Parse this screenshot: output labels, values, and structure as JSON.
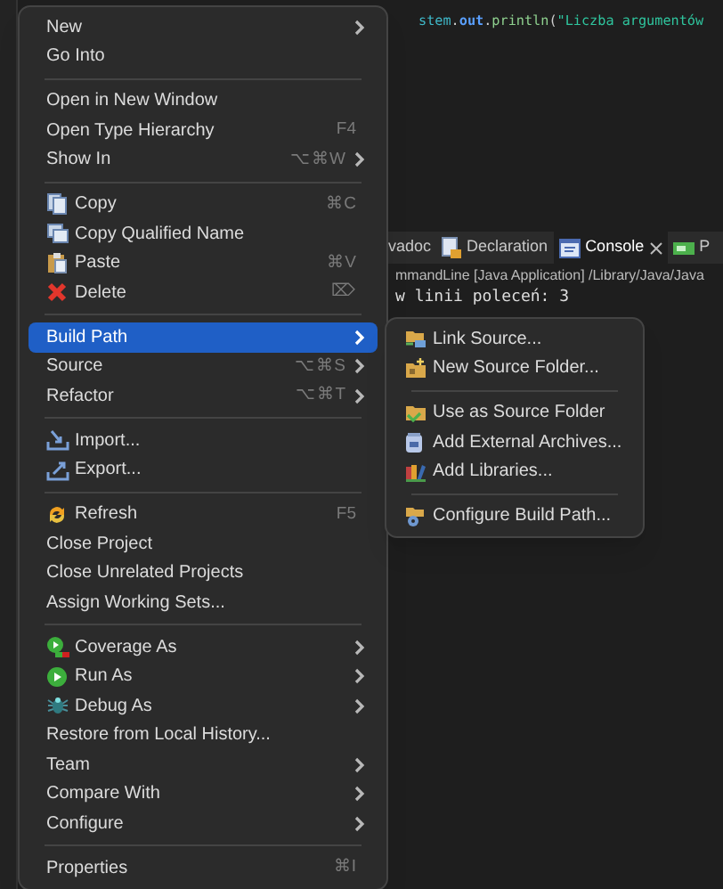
{
  "editor": {
    "code_tokens": [
      {
        "kind": "ident",
        "text": "stem"
      },
      {
        "kind": "punct",
        "text": "."
      },
      {
        "kind": "field",
        "text": "out"
      },
      {
        "kind": "punct",
        "text": "."
      },
      {
        "kind": "method",
        "text": "println"
      },
      {
        "kind": "punct",
        "text": "("
      },
      {
        "kind": "string",
        "text": "\"Liczba argumentów"
      }
    ]
  },
  "bottom_panel": {
    "tabs": [
      {
        "label": "vadoc",
        "selected": false
      },
      {
        "label": "Declaration",
        "selected": false
      },
      {
        "label": "Console",
        "selected": true
      },
      {
        "label": "P",
        "selected": false
      }
    ],
    "console_header": "mmandLine [Java Application] /Library/Java/Java",
    "console_output": "w linii poleceń: 3"
  },
  "context_menu": {
    "items": [
      {
        "kind": "item",
        "label": "New",
        "submenu": true,
        "selected": false
      },
      {
        "kind": "item",
        "label": "Go Into",
        "submenu": false,
        "selected": false
      },
      {
        "kind": "separator"
      },
      {
        "kind": "item",
        "label": "Open in New Window",
        "submenu": false,
        "selected": false
      },
      {
        "kind": "item",
        "label": "Open Type Hierarchy",
        "shortcut": "F4",
        "submenu": false,
        "selected": false
      },
      {
        "kind": "item",
        "label": "Show In",
        "shortcut": "⌥⌘W",
        "submenu": true,
        "selected": false
      },
      {
        "kind": "separator"
      },
      {
        "kind": "item",
        "label": "Copy",
        "shortcut": "⌘C",
        "submenu": false,
        "selected": false
      },
      {
        "kind": "item",
        "label": "Copy Qualified Name",
        "submenu": false,
        "selected": false
      },
      {
        "kind": "item",
        "label": "Paste",
        "shortcut": "⌘V",
        "submenu": false,
        "selected": false
      },
      {
        "kind": "item",
        "label": "Delete",
        "shortcut": "⌦",
        "submenu": false,
        "selected": false
      },
      {
        "kind": "separator"
      },
      {
        "kind": "item",
        "label": "Build Path",
        "submenu": true,
        "selected": true
      },
      {
        "kind": "item",
        "label": "Source",
        "shortcut": "⌥⌘S",
        "submenu": true,
        "selected": false
      },
      {
        "kind": "item",
        "label": "Refactor",
        "shortcut": "⌥⌘T",
        "submenu": true,
        "selected": false
      },
      {
        "kind": "separator"
      },
      {
        "kind": "item",
        "label": "Import...",
        "submenu": false,
        "selected": false
      },
      {
        "kind": "item",
        "label": "Export...",
        "submenu": false,
        "selected": false
      },
      {
        "kind": "separator"
      },
      {
        "kind": "item",
        "label": "Refresh",
        "shortcut": "F5",
        "submenu": false,
        "selected": false
      },
      {
        "kind": "item",
        "label": "Close Project",
        "submenu": false,
        "selected": false
      },
      {
        "kind": "item",
        "label": "Close Unrelated Projects",
        "submenu": false,
        "selected": false
      },
      {
        "kind": "item",
        "label": "Assign Working Sets...",
        "submenu": false,
        "selected": false
      },
      {
        "kind": "separator"
      },
      {
        "kind": "item",
        "label": "Coverage As",
        "submenu": true,
        "selected": false
      },
      {
        "kind": "item",
        "label": "Run As",
        "submenu": true,
        "selected": false
      },
      {
        "kind": "item",
        "label": "Debug As",
        "submenu": true,
        "selected": false
      },
      {
        "kind": "item",
        "label": "Restore from Local History...",
        "submenu": false,
        "selected": false
      },
      {
        "kind": "item",
        "label": "Team",
        "submenu": true,
        "selected": false
      },
      {
        "kind": "item",
        "label": "Compare With",
        "submenu": true,
        "selected": false
      },
      {
        "kind": "item",
        "label": "Configure",
        "submenu": true,
        "selected": false
      },
      {
        "kind": "separator"
      },
      {
        "kind": "item",
        "label": "Properties",
        "shortcut": "⌘I",
        "submenu": false,
        "selected": false
      }
    ]
  },
  "submenu": {
    "items": [
      {
        "kind": "item",
        "label": "Link Source..."
      },
      {
        "kind": "item",
        "label": "New Source Folder..."
      },
      {
        "kind": "separator"
      },
      {
        "kind": "item",
        "label": "Use as Source Folder"
      },
      {
        "kind": "item",
        "label": "Add External Archives..."
      },
      {
        "kind": "item",
        "label": "Add Libraries..."
      },
      {
        "kind": "separator"
      },
      {
        "kind": "item",
        "label": "Configure Build Path..."
      }
    ]
  }
}
